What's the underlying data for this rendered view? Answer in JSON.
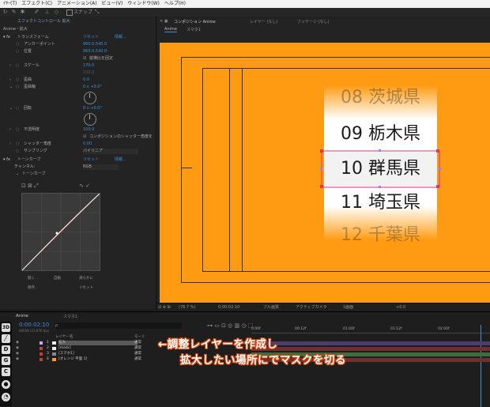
{
  "menubar": {
    "items": [
      "ｲﾔｰ(T)",
      "エフェクト(C)",
      "アニメーション(A)",
      "ビュー(V)",
      "ウィンドウ(W)",
      "ヘルプ(H)"
    ]
  },
  "toolbar": {
    "snap_label": "スナップ"
  },
  "effects_panel": {
    "tab": "エフェクトコントロール 拡大",
    "header": "Anime・拡大",
    "reset": "リセット",
    "info": "情報...",
    "transform": "トランスフォーム",
    "anchor_label": "アンカーポイント",
    "anchor_value": "960.0,540.0",
    "position_label": "位置",
    "position_value": "960.0,540.0",
    "uniform_scale": "縦横比を固定",
    "scale_label": "スケール",
    "scale_value": "170.0",
    "scale_sub_value": "100.0",
    "skew_label": "歪曲",
    "skew_value": "0.0",
    "skew_axis_label": "歪曲軸",
    "skew_axis_value": "0 x +0.0°",
    "rotation_label": "回転",
    "rotation_value": "0 x +0.0°",
    "opacity_label": "不透明度",
    "opacity_value": "100.0",
    "comp_shutter": "コンポジションのシャッター角度を",
    "shutter_label": "シャッター角度",
    "shutter_value": "0.00",
    "sampling_label": "サンプリング",
    "sampling_value": "バイリニア",
    "curves": "トーンカーブ",
    "curves_reset": "リセット",
    "curves_info": "情報...",
    "channel_label": "チャンネル:",
    "channel_value": "RGB",
    "curve_sub": "トーンカーブ",
    "btn_open": "開く...",
    "btn_auto": "自動",
    "btn_smooth": "滑らかに",
    "btn_save": "保存...",
    "btn_reset": "リセット"
  },
  "viewer": {
    "tab": "コンポジション Anime",
    "layer_tab": "レイヤー (なし)",
    "footage_tab": "フッテージ (なし)",
    "comp_name": "Anime",
    "sub_comp": "スマホ1",
    "prefectures": [
      "08 茨城県",
      "09 栃木県",
      "10 群馬県",
      "11 埼玉県",
      "12 千葉県"
    ],
    "zoom": "(76.7 %)",
    "timecode": "0:00:02:10",
    "quality": "フル画質",
    "camera": "アクティブカメラ",
    "views": "1画面",
    "exposure": "+0.0"
  },
  "timeline": {
    "comp_tab": "Anime",
    "sub_tab": "スマホ1",
    "timecode": "0:00:02:10",
    "fps": "00058 (23.976 fps)",
    "search_placeholder": "ρ.",
    "col_layer_name": "レイヤー名",
    "col_mode": "モード",
    "layers": [
      {
        "num": "1",
        "name": "拡大",
        "mode": "通常"
      },
      {
        "num": "2",
        "name": "[mask]",
        "mode": "通常"
      },
      {
        "num": "3",
        "name": "[スマホ1]",
        "mode": "通常"
      },
      {
        "num": "4",
        "name": "[オレンジ 平面 1]",
        "mode": "通常"
      }
    ],
    "ruler": [
      "0:00f",
      "00:12f",
      "01:00f",
      "01:12f",
      "02:00f"
    ]
  },
  "annotation": {
    "line1": "←調整レイヤーを作成し",
    "line2": "拡大したい場所にでマスクを切る"
  },
  "sidebar_icons": [
    "3D",
    "D",
    "G",
    "C"
  ],
  "colors": {
    "orange": "#ff9b12",
    "accent_blue": "#3d8fd8",
    "mask_pink": "#e0307a",
    "annot_outline": "#d8460a"
  }
}
